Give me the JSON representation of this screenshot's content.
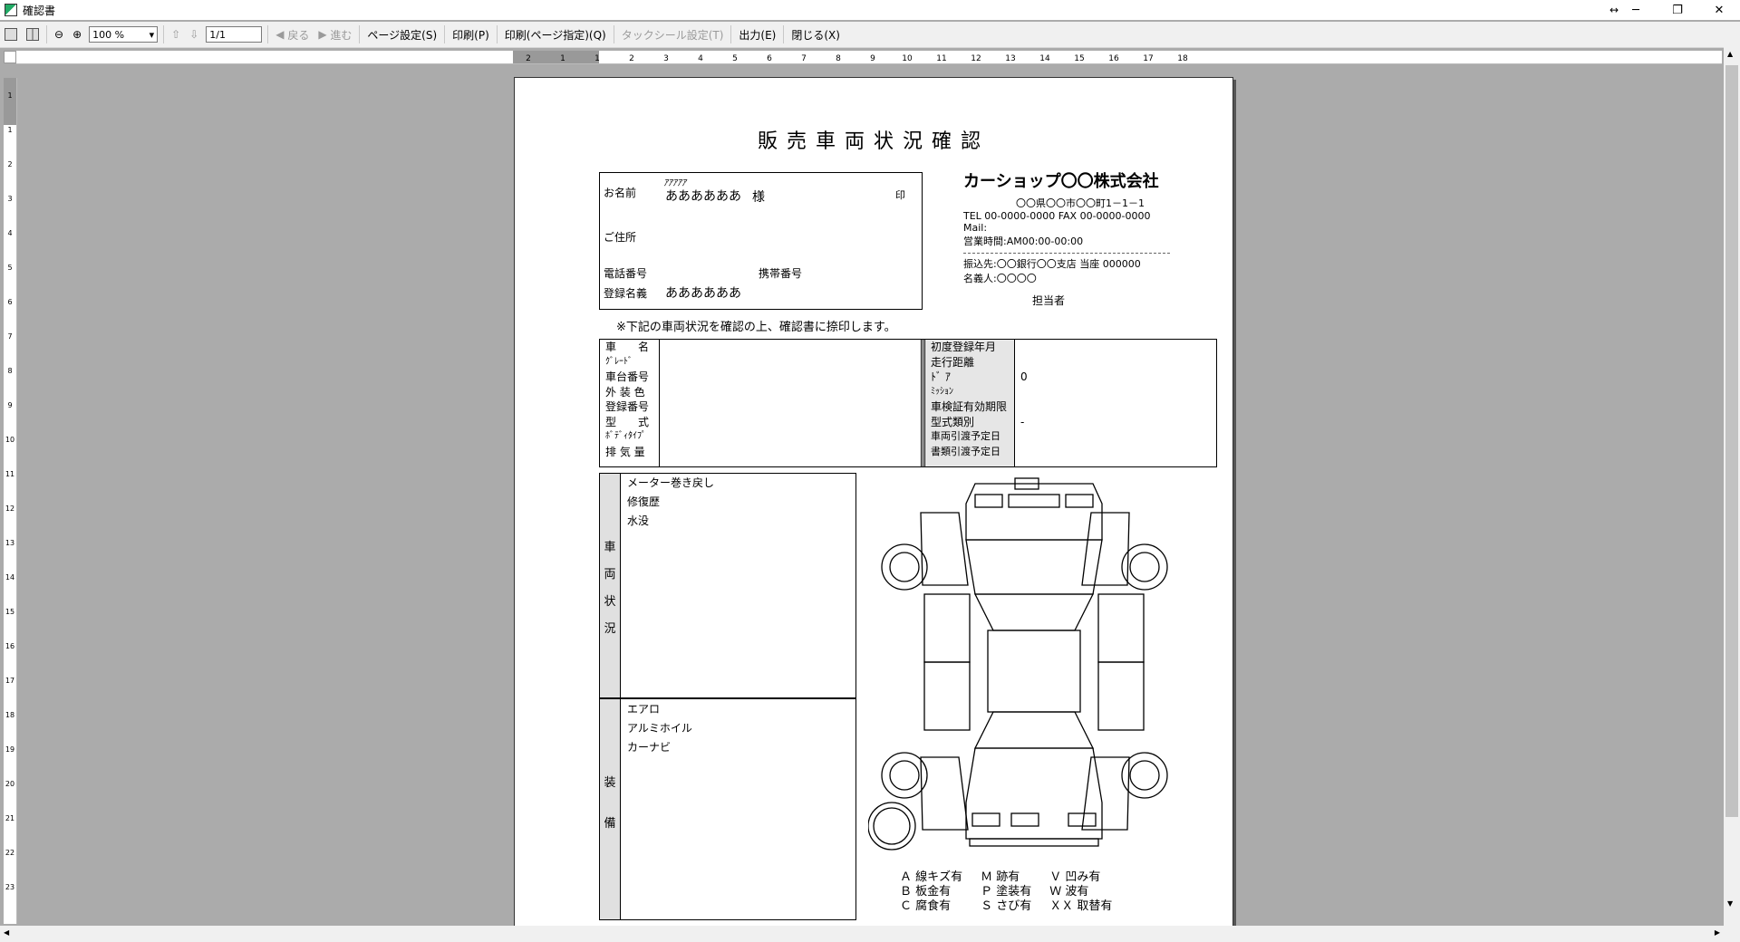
{
  "window": {
    "title": "確認書",
    "minimize": "─",
    "maximize": "❐",
    "close": "✕"
  },
  "toolbar": {
    "zoom_value": "100 %",
    "page_value": "1/1",
    "back_label": "戻る",
    "forward_label": "進む",
    "page_setup_label": "ページ設定(S)",
    "print_label": "印刷(P)",
    "print_page_label": "印刷(ページ指定)(Q)",
    "tack_seal_label": "タックシール設定(T)",
    "output_label": "出力(E)",
    "close_label": "閉じる(X)"
  },
  "ruler": {
    "h_ticks": [
      "2",
      "1",
      "1",
      "2",
      "3",
      "4",
      "5",
      "6",
      "7",
      "8",
      "9",
      "10",
      "11",
      "12",
      "13",
      "14",
      "15",
      "16",
      "17",
      "18"
    ],
    "v_ticks": [
      "1",
      "1",
      "2",
      "3",
      "4",
      "5",
      "6",
      "7",
      "8",
      "9",
      "10",
      "11",
      "12",
      "13",
      "14",
      "15",
      "16",
      "17",
      "18",
      "19",
      "20",
      "21",
      "22",
      "23"
    ]
  },
  "doc": {
    "title": "販売車両状況確認",
    "customer": {
      "name_label": "お名前",
      "furigana": "ｱｱｱｱｱ",
      "name_value": "ああああああ",
      "honorific": "様",
      "seal_label": "印",
      "address_label": "ご住所",
      "phone_label": "電話番号",
      "mobile_label": "携帯番号",
      "registered_name_label": "登録名義",
      "registered_name_value": "ああああああ"
    },
    "shop": {
      "name": "カーショップ〇〇株式会社",
      "address": "〇〇県〇〇市〇〇町1－1－1",
      "tel_fax": "TEL 00-0000-0000  FAX 00-0000-0000",
      "mail": "Mail:",
      "hours": "営業時間:AM00:00-00:00",
      "bank": "振込先:〇〇銀行〇〇支店  当座  000000",
      "holder": "名義人:〇〇〇〇",
      "staff_label": "担当者"
    },
    "note": "※下記の車両状況を確認の上、確認書に捺印します。",
    "spec_left_labels": [
      "車　　名",
      "ｸﾞﾚｰﾄﾞ",
      "車台番号",
      "外 装 色",
      "登録番号",
      "型　　式",
      "ﾎﾞﾃﾞｨﾀｲﾌﾟ",
      "排 気 量"
    ],
    "spec_right_labels": [
      "初度登録年月",
      "走行距離",
      "ﾄﾞ ｱ",
      "ﾐｯｼｮﾝ",
      "車検証有効期限",
      "型式類別",
      "車両引渡予定日",
      "書類引渡予定日"
    ],
    "spec_right_values": [
      "",
      "",
      "0",
      "",
      "",
      "-",
      "",
      ""
    ],
    "condition_side": [
      "車",
      "両",
      "状",
      "況"
    ],
    "condition_items": [
      "メーター巻き戻し",
      "修復歴",
      "水没"
    ],
    "equipment_side": [
      "装",
      "備"
    ],
    "equipment_items": [
      "エアロ",
      "アルミホイル",
      "カーナビ"
    ],
    "legend": [
      [
        "Ａ  線キズ有",
        "Ｍ  跡有",
        "Ｖ  凹み有"
      ],
      [
        "Ｂ  板金有",
        "Ｐ  塗装有",
        "Ｗ  波有"
      ],
      [
        "Ｃ  腐食有",
        "Ｓ  さび有",
        "ＸＸ  取替有"
      ]
    ]
  }
}
